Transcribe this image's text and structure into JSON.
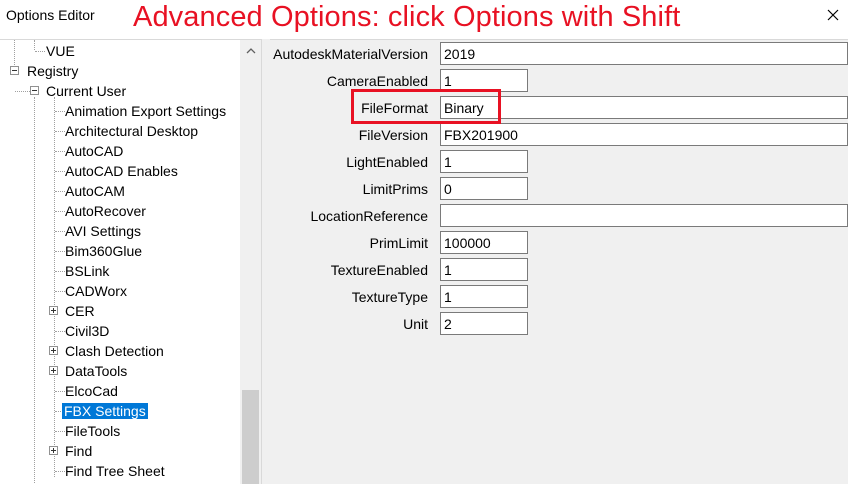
{
  "window": {
    "title": "Options Editor",
    "annotation": "Advanced Options: click Options with Shift",
    "annotation_color": "#e81123"
  },
  "tree": {
    "items": [
      {
        "label": "VUE"
      },
      {
        "label": "Registry"
      },
      {
        "label": "Current User"
      },
      {
        "label": "Animation Export Settings"
      },
      {
        "label": "Architectural Desktop"
      },
      {
        "label": "AutoCAD"
      },
      {
        "label": "AutoCAD Enables"
      },
      {
        "label": "AutoCAM"
      },
      {
        "label": "AutoRecover"
      },
      {
        "label": "AVI Settings"
      },
      {
        "label": "Bim360Glue"
      },
      {
        "label": "BSLink"
      },
      {
        "label": "CADWorx"
      },
      {
        "label": "CER"
      },
      {
        "label": "Civil3D"
      },
      {
        "label": "Clash Detection"
      },
      {
        "label": "DataTools"
      },
      {
        "label": "ElcoCad"
      },
      {
        "label": "FBX Settings"
      },
      {
        "label": "FileTools"
      },
      {
        "label": "Find"
      },
      {
        "label": "Find Tree Sheet"
      }
    ],
    "selected": "FBX Settings",
    "selection_color": "#0078d7"
  },
  "properties": [
    {
      "label": "AutodeskMaterialVersion",
      "value": "2019"
    },
    {
      "label": "CameraEnabled",
      "value": "1"
    },
    {
      "label": "FileFormat",
      "value": "Binary"
    },
    {
      "label": "FileVersion",
      "value": "FBX201900"
    },
    {
      "label": "LightEnabled",
      "value": "1"
    },
    {
      "label": "LimitPrims",
      "value": "0"
    },
    {
      "label": "LocationReference",
      "value": ""
    },
    {
      "label": "PrimLimit",
      "value": "100000"
    },
    {
      "label": "TextureEnabled",
      "value": "1"
    },
    {
      "label": "TextureType",
      "value": "1"
    },
    {
      "label": "Unit",
      "value": "2"
    }
  ]
}
